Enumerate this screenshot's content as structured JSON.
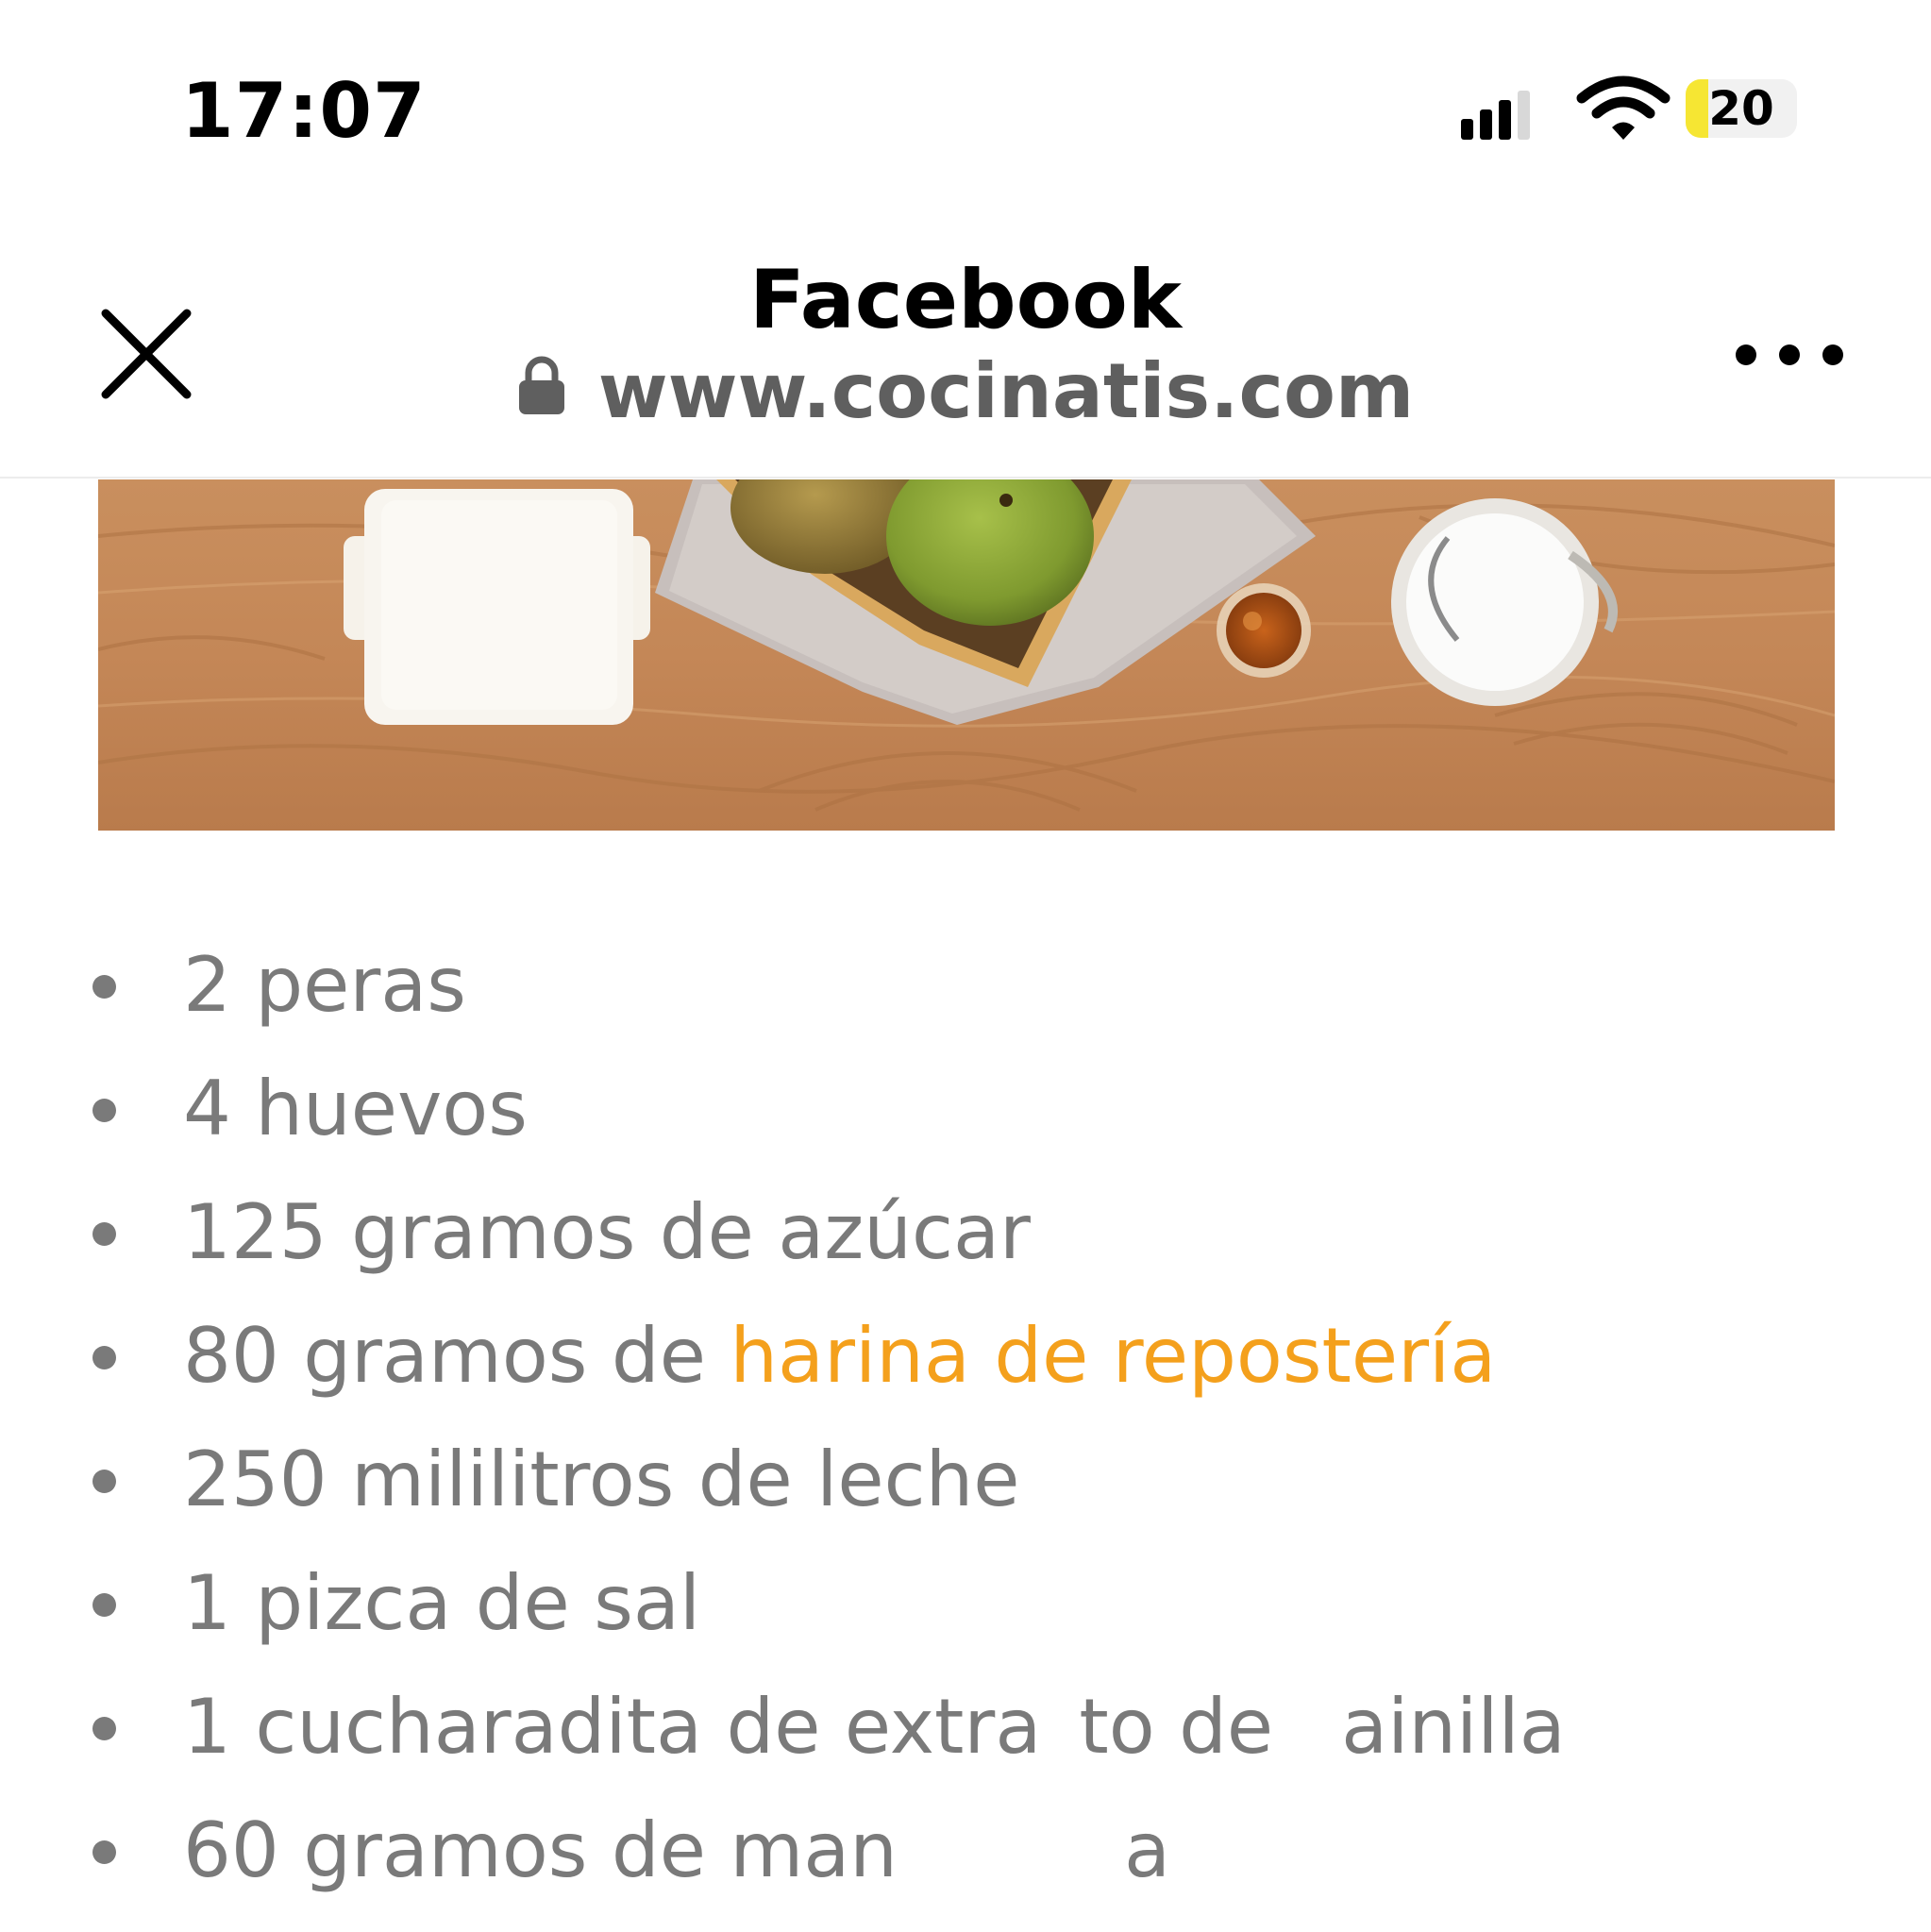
{
  "status_bar": {
    "time": "17:07",
    "battery_level": "20",
    "battery_fraction": 0.2,
    "signal_icon": "cellular-signal-icon",
    "wifi_icon": "wifi-icon"
  },
  "header": {
    "title": "Facebook",
    "url": "www.cocinatis.com",
    "close_icon": "close-icon",
    "lock_icon": "lock-icon",
    "more_icon": "more-horizontal-icon"
  },
  "hero_image": {
    "alt": "pears-flour-honey-milk-photo"
  },
  "ingredients": {
    "items": [
      {
        "text": "2 peras"
      },
      {
        "text": "4 huevos"
      },
      {
        "text": "125 gramos de azúcar"
      },
      {
        "prefix": "80 gramos de ",
        "link": "harina de repostería"
      },
      {
        "text": "250 mililitros de leche"
      },
      {
        "text": "1 pizca de sal"
      },
      {
        "part1": "1 cucharadita de extra",
        "part2": "to de",
        "part3": "ainilla"
      },
      {
        "part1": "60 gramos de man",
        "part2": "a"
      }
    ]
  },
  "colors": {
    "text_gray": "#7a7a7a",
    "link_orange": "#f4a01c",
    "url_gray": "#5f5f5f",
    "battery_yellow": "#f6e633"
  }
}
